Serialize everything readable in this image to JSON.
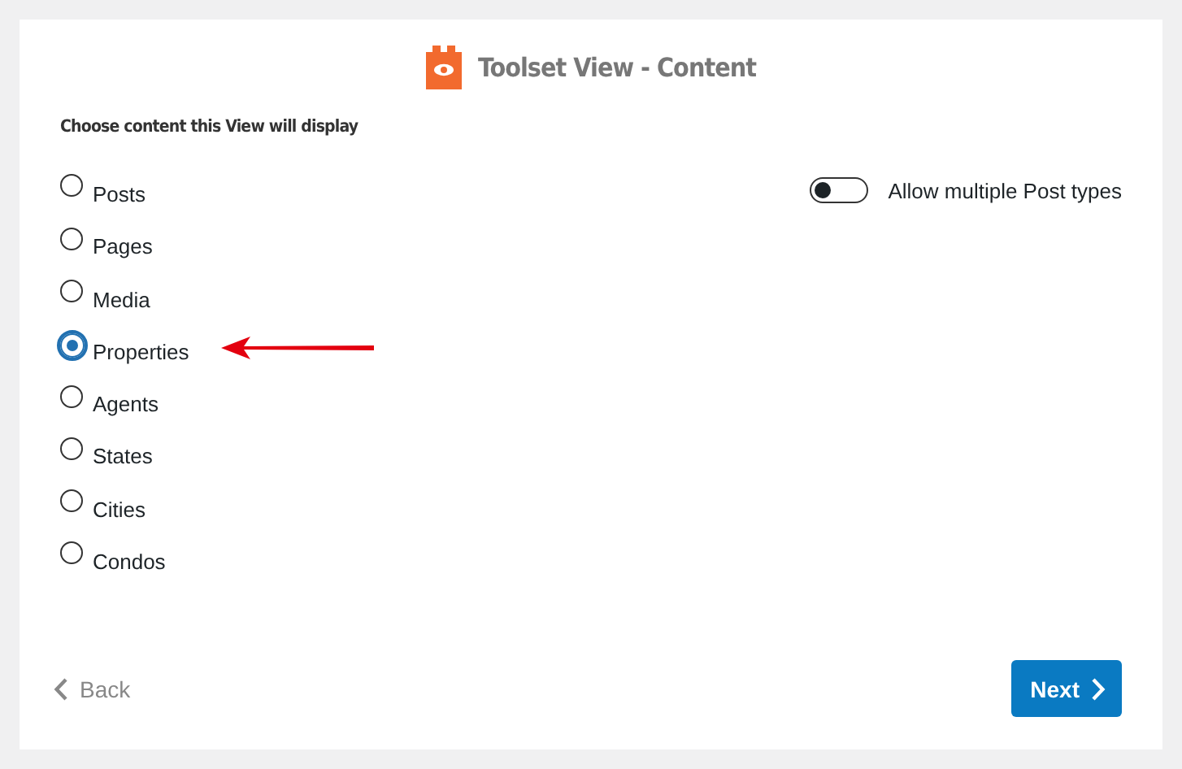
{
  "dialog": {
    "title": "Toolset View - Content"
  },
  "prompt": "Choose content this View will display",
  "options": [
    {
      "label": "Posts",
      "selected": false
    },
    {
      "label": "Pages",
      "selected": false
    },
    {
      "label": "Media",
      "selected": false
    },
    {
      "label": "Properties",
      "selected": true
    },
    {
      "label": "Agents",
      "selected": false
    },
    {
      "label": "States",
      "selected": false
    },
    {
      "label": "Cities",
      "selected": false
    },
    {
      "label": "Condos",
      "selected": false
    }
  ],
  "toggle": {
    "label": "Allow multiple Post types",
    "on": false
  },
  "buttons": [
    {
      "kind": "back",
      "label": "Back"
    },
    {
      "kind": "next",
      "label": "Next"
    }
  ]
}
